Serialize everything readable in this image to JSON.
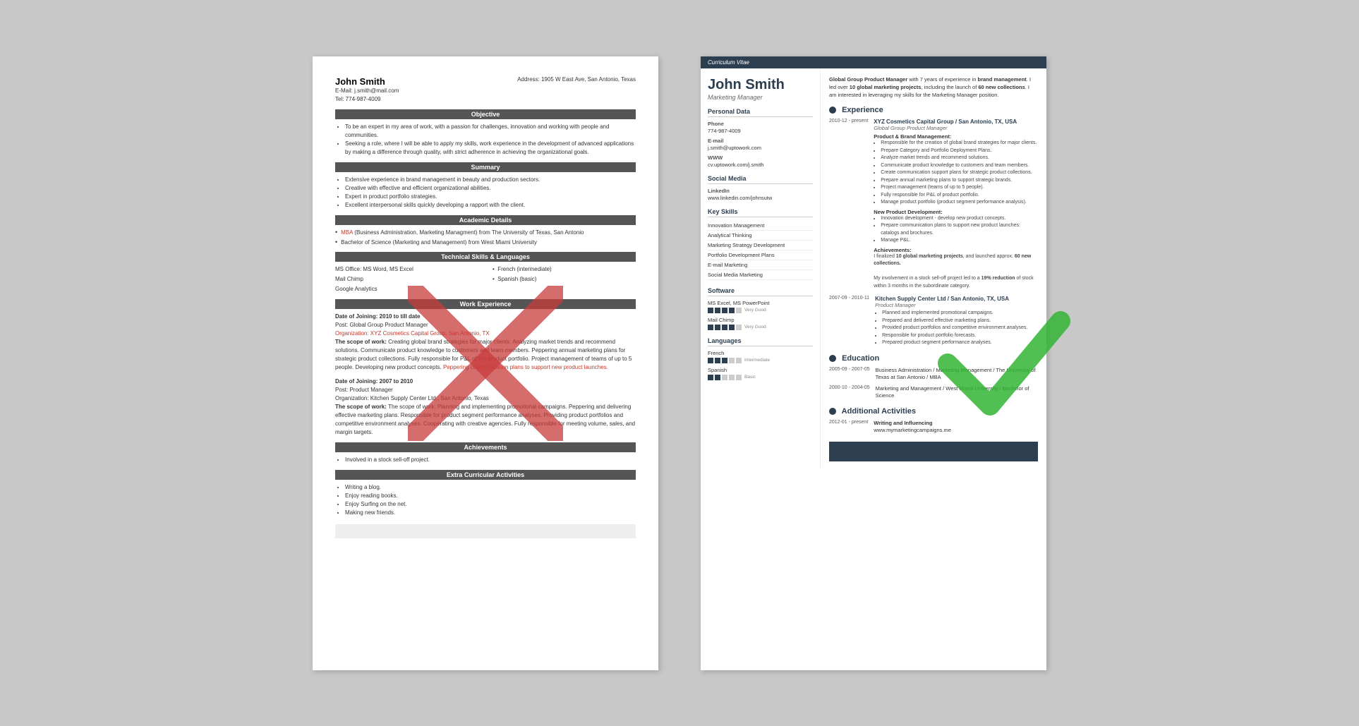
{
  "background_color": "#c8c8c8",
  "left_resume": {
    "name": "John Smith",
    "email": "E-Mail: j.smith@mail.com",
    "phone": "Tel: 774-987-4009",
    "address": "Address: 1905 W East Ave, San Antonio, Texas",
    "sections": {
      "objective": {
        "title": "Objective",
        "items": [
          "To be an expert in my area of work, with a passion for challenges, innovation and working with people and communities.",
          "Seeking a role, where I will be able to apply my skills, work experience in the development of advanced applications by making a difference through quality, with strict adherence in achieving the organizational goals."
        ]
      },
      "summary": {
        "title": "Summary",
        "items": [
          "Extensive experience in brand management in beauty and production sectors.",
          "Creative with effective and efficient organizational abilities.",
          "Expert in product portfolio strategies.",
          "Excellent interpersonal skills quickly developing a rapport with the client."
        ]
      },
      "academic": {
        "title": "Academic Details",
        "items": [
          {
            "highlight": "MBA",
            "text": " (Business Administration, Marketing Managment) from The University of Texas, San Antonio"
          },
          {
            "highlight": "",
            "text": "Bachelor of Science (Marketing and Management) from West Miami University"
          }
        ]
      },
      "technical": {
        "title": "Technical Skills & Languages",
        "skills": [
          {
            "label": "MS Office: MS Word, MS Excel",
            "right": "French (intermediate)"
          },
          {
            "label": "Mail Chimp",
            "right": "Spanish (basic)"
          },
          {
            "label": "Google Analytics",
            "right": ""
          }
        ]
      },
      "work_experience": {
        "title": "Work Experience",
        "entries": [
          {
            "date_of_joining": "Date of Joining: 2010 to till date",
            "post": "Post: Global Group Product Manager",
            "org": "Organization: XYZ Cosmetics Capital Group, San Antonio, TX",
            "scope": "The scope of work: Creating global brand strategies for major clients. Analyzing market trends and recommend solutions. Communicate product knowledge to customers and team members. Peppering annual marketing plans for strategic product collections. Fully responsible for P&L of the product portfolio. Project management of teams of up to 5 people. Developing new product concepts. Peppering communication plans to support new product launches."
          },
          {
            "date_of_joining": "Date of Joining: 2007 to 2010",
            "post": "Post: Product Manager",
            "org": "Organization: Kitchen Supply Center Ltd., San Antonio, Texas",
            "scope": "The scope of work: Planning and implementing promotional campaigns. Peppering and delivering effective marketing plans. Responsible for product segment performance analyses. Providing product portfolios and competitive environment analyses. Cooperating with creative agencies. Fully responsible for meeting volume, sales, and margin targets."
          }
        ]
      },
      "achievements": {
        "title": "Achievements",
        "items": [
          "Involved in a stock sell-off project."
        ]
      },
      "extra": {
        "title": "Extra Curricular Activities",
        "items": [
          "Writing a blog.",
          "Enjoy reading books.",
          "Enjoy Surfing on the net.",
          "Making new friends."
        ]
      }
    }
  },
  "right_resume": {
    "curriculum_vitae_label": "Curriculum Vitae",
    "name": "John Smith",
    "title": "Marketing Manager",
    "summary": "Global Group Product Manager with 7 years of experience in brand management. I led over 10 global marketing projects, including the launch of 60 new collections. I am interested in leveraging my skills for the Marketing Manager position.",
    "personal_data": {
      "section_title": "Personal Data",
      "phone_label": "Phone",
      "phone": "774-987-4009",
      "email_label": "E-mail",
      "email": "j.smith@uptowork.com",
      "www_label": "WWW",
      "www": "cv.uptowork.com/j.smith"
    },
    "social_media": {
      "section_title": "Social Media",
      "linkedin_label": "LinkedIn",
      "linkedin": "www.linkedin.com/johnsutw"
    },
    "key_skills": {
      "section_title": "Key Skills",
      "items": [
        "Innovation Management",
        "Analytical Thinking",
        "Marketing Strategy Development",
        "Portfolio Development Plans",
        "E-mail Marketing",
        "Social Media Marketing"
      ]
    },
    "software": {
      "section_title": "Software",
      "items": [
        {
          "name": "MS Excel, MS PowerPoint",
          "level": 4,
          "max": 5,
          "label": "Very Good"
        },
        {
          "name": "Mail Chimp",
          "level": 4,
          "max": 5,
          "label": "Very Good"
        }
      ]
    },
    "languages": {
      "section_title": "Languages",
      "items": [
        {
          "name": "French",
          "level": 3,
          "max": 5,
          "label": "Intermediate"
        },
        {
          "name": "Spanish",
          "level": 2,
          "max": 5,
          "label": "Basic"
        }
      ]
    },
    "experience": {
      "section_title": "Experience",
      "entries": [
        {
          "dates": "2010-12 - present",
          "company": "XYZ Cosmetics Capital Group / San Antonio, TX, USA",
          "job_title": "Global Group Product Manager",
          "subsections": [
            {
              "title": "Product & Brand Management:",
              "bullets": [
                "Responsible for the creation of global brand strategies for major clients.",
                "Prepare Category and Portfolio Deployment Plans.",
                "Analyze market trends and recommend solutions.",
                "Communicate product knowledge to customers and team members.",
                "Create communication support plans for strategic product collections.",
                "Prepare annual marketing plans to support strategic brands.",
                "Project management (teams of up to 5 people).",
                "Fully responsible for P&L of product portfolio.",
                "Manage product portfolio (product segment performance analysis)."
              ]
            },
            {
              "title": "New Product Development:",
              "bullets": [
                "Innovation development - develop new product concepts.",
                "Prepare communication plans to support new product launches: catalogs and brochures.",
                "Manage P&L."
              ]
            },
            {
              "title": "Achievements:",
              "text": "I finalized 10 global marketing projects, and launched approx. 60 new collections.\n\nMy involvement in a stock sell-off project led to a 19% reduction of stock within 3 months in the subordinate category."
            }
          ]
        },
        {
          "dates": "2007-09 - 2010-11",
          "company": "Kitchen Supply Center Ltd / San Antonio, TX, USA",
          "job_title": "Product Manager",
          "bullets": [
            "Planned and implemented promotional campaigns.",
            "Prepared and delivered effective marketing plans.",
            "Provided product portfolios and competitive environment analyses.",
            "Responsible for product portfolio forecasts.",
            "Prepared product segment performance analyses."
          ]
        }
      ]
    },
    "education": {
      "section_title": "Education",
      "entries": [
        {
          "dates": "2005-09 - 2007-05",
          "text": "Business Administration / Marketing Management / The University of Texas at San Antonio / MBA"
        },
        {
          "dates": "2000-10 - 2004-05",
          "text": "Marketing and Management / West Miami University / Bachelor of Science"
        }
      ]
    },
    "additional": {
      "section_title": "Additional Activities",
      "entries": [
        {
          "dates": "2012-01 - present",
          "title": "Writing and Influencing",
          "text": "www.mymarketingcampaigns.me"
        }
      ]
    }
  }
}
